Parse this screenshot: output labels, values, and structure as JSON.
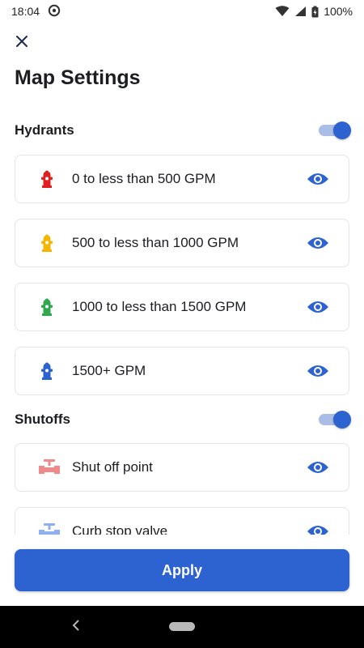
{
  "status_bar": {
    "time": "18:04",
    "battery": "100%"
  },
  "header": {
    "title": "Map Settings"
  },
  "sections": {
    "hydrants": {
      "label": "Hydrants",
      "enabled": true,
      "items": [
        {
          "label": "0 to less than 500 GPM",
          "icon": "hydrant-icon",
          "color": "#e02020"
        },
        {
          "label": "500 to less than 1000 GPM",
          "icon": "hydrant-icon",
          "color": "#f2b705"
        },
        {
          "label": "1000 to less than 1500 GPM",
          "icon": "hydrant-icon",
          "color": "#2fa84f"
        },
        {
          "label": "1500+ GPM",
          "icon": "hydrant-icon",
          "color": "#2c63d1"
        }
      ]
    },
    "shutoffs": {
      "label": "Shutoffs",
      "enabled": true,
      "items": [
        {
          "label": "Shut off point",
          "icon": "shutoff-point-icon",
          "color": "#ef8a8a"
        },
        {
          "label": "Curb stop valve",
          "icon": "curb-stop-valve-icon",
          "color": "#8fb0ee"
        }
      ]
    }
  },
  "footer": {
    "apply_label": "Apply"
  },
  "colors": {
    "accent": "#2c63d1",
    "toggle_track": "#a9bde6"
  }
}
